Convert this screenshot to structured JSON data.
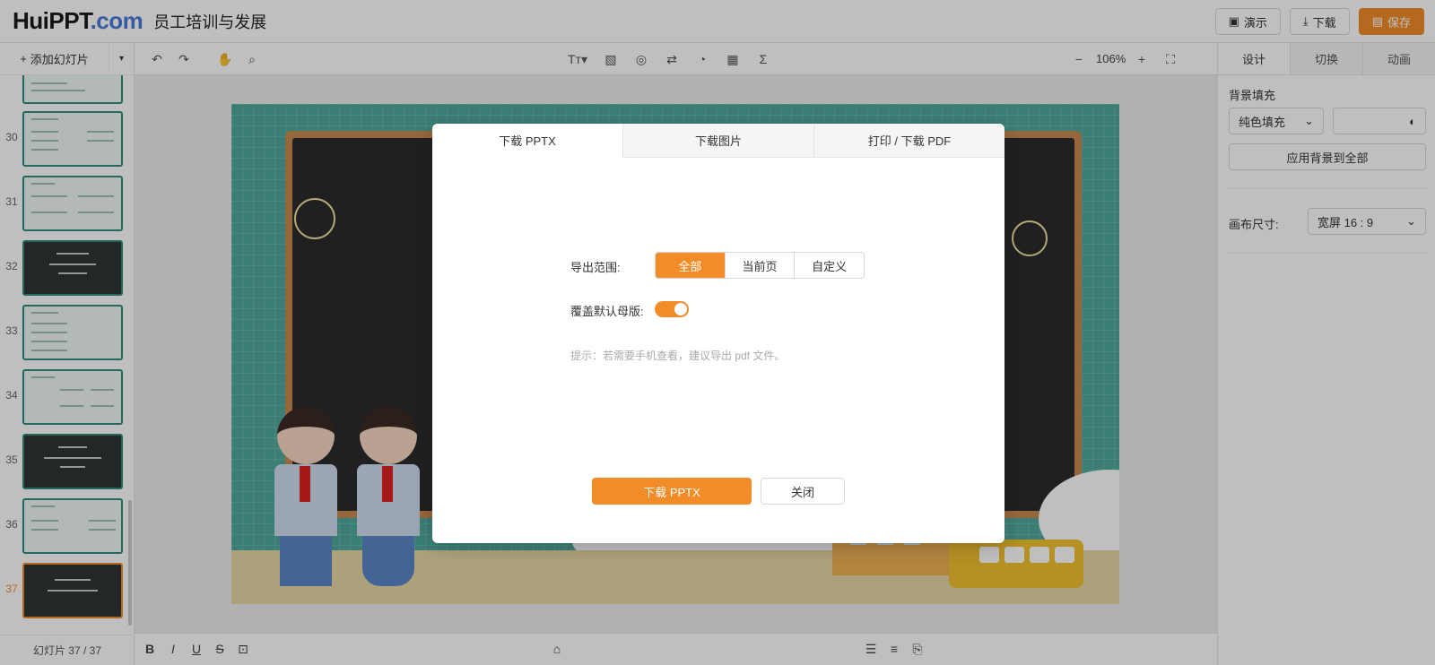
{
  "header": {
    "logo_part1": "HuiPPT",
    "logo_part2": ".com",
    "title": "员工培训与发展",
    "present_label": "演示",
    "download_label": "下载",
    "save_label": "保存"
  },
  "sidebar": {
    "add_slide_label": "添加幻灯片",
    "slides": [
      {
        "num": "",
        "dark": false
      },
      {
        "num": "30",
        "dark": false
      },
      {
        "num": "31",
        "dark": false
      },
      {
        "num": "32",
        "dark": true
      },
      {
        "num": "33",
        "dark": false
      },
      {
        "num": "34",
        "dark": false
      },
      {
        "num": "35",
        "dark": true
      },
      {
        "num": "36",
        "dark": false
      },
      {
        "num": "37",
        "dark": true,
        "active": true
      }
    ],
    "slide_count": "幻灯片 37 / 37"
  },
  "toolbar": {
    "zoom": "106%"
  },
  "right_panel": {
    "tabs": [
      "设计",
      "切换",
      "动画"
    ],
    "bg_fill_label": "背景填充",
    "fill_type": "纯色填充",
    "apply_all_label": "应用背景到全部",
    "canvas_size_label": "画布尺寸:",
    "canvas_size_value": "宽屏 16 : 9"
  },
  "modal": {
    "tabs": [
      "下载 PPTX",
      "下载图片",
      "打印 / 下载 PDF"
    ],
    "range_label": "导出范围:",
    "range_options": [
      "全部",
      "当前页",
      "自定义"
    ],
    "override_label": "覆盖默认母版:",
    "override_on": true,
    "hint": "提示：若需要手机查看，建议导出 pdf 文件。",
    "download_button": "下载 PPTX",
    "close_button": "关闭"
  },
  "colors": {
    "accent": "#f28c28",
    "slide_bg": "#4fa89b",
    "board": "#2b2b2b"
  }
}
